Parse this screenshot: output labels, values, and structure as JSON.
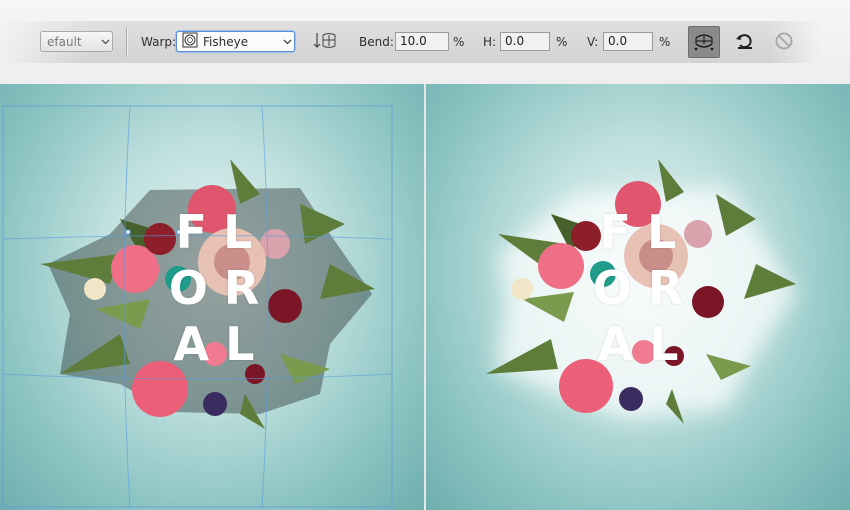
{
  "toolbar": {
    "preset_value": "efault",
    "warp_label": "Warp:",
    "warp_value": "Fisheye",
    "bend_label": "Bend:",
    "bend_value": "10.0",
    "bend_unit": "%",
    "h_label": "H:",
    "h_value": "0.0",
    "h_unit": "%",
    "v_label": "V:",
    "v_value": "0.0",
    "v_unit": "%",
    "icons": [
      "chevron-down-icon",
      "fisheye-icon",
      "warp-orientation-icon",
      "toggle-warp-mode-icon",
      "cancel-transform-icon",
      "commit-cancel-icon"
    ],
    "active_icon": "toggle-warp-mode-icon"
  },
  "canvas": {
    "left_text_lines": [
      "FL",
      "OR",
      "AL"
    ],
    "right_text_lines": [
      "FL",
      "OR",
      "AL"
    ],
    "background_colors": [
      "#eaf5f4",
      "#8fc6c4",
      "#6eafae"
    ],
    "guide_color": "#5a9be0"
  }
}
